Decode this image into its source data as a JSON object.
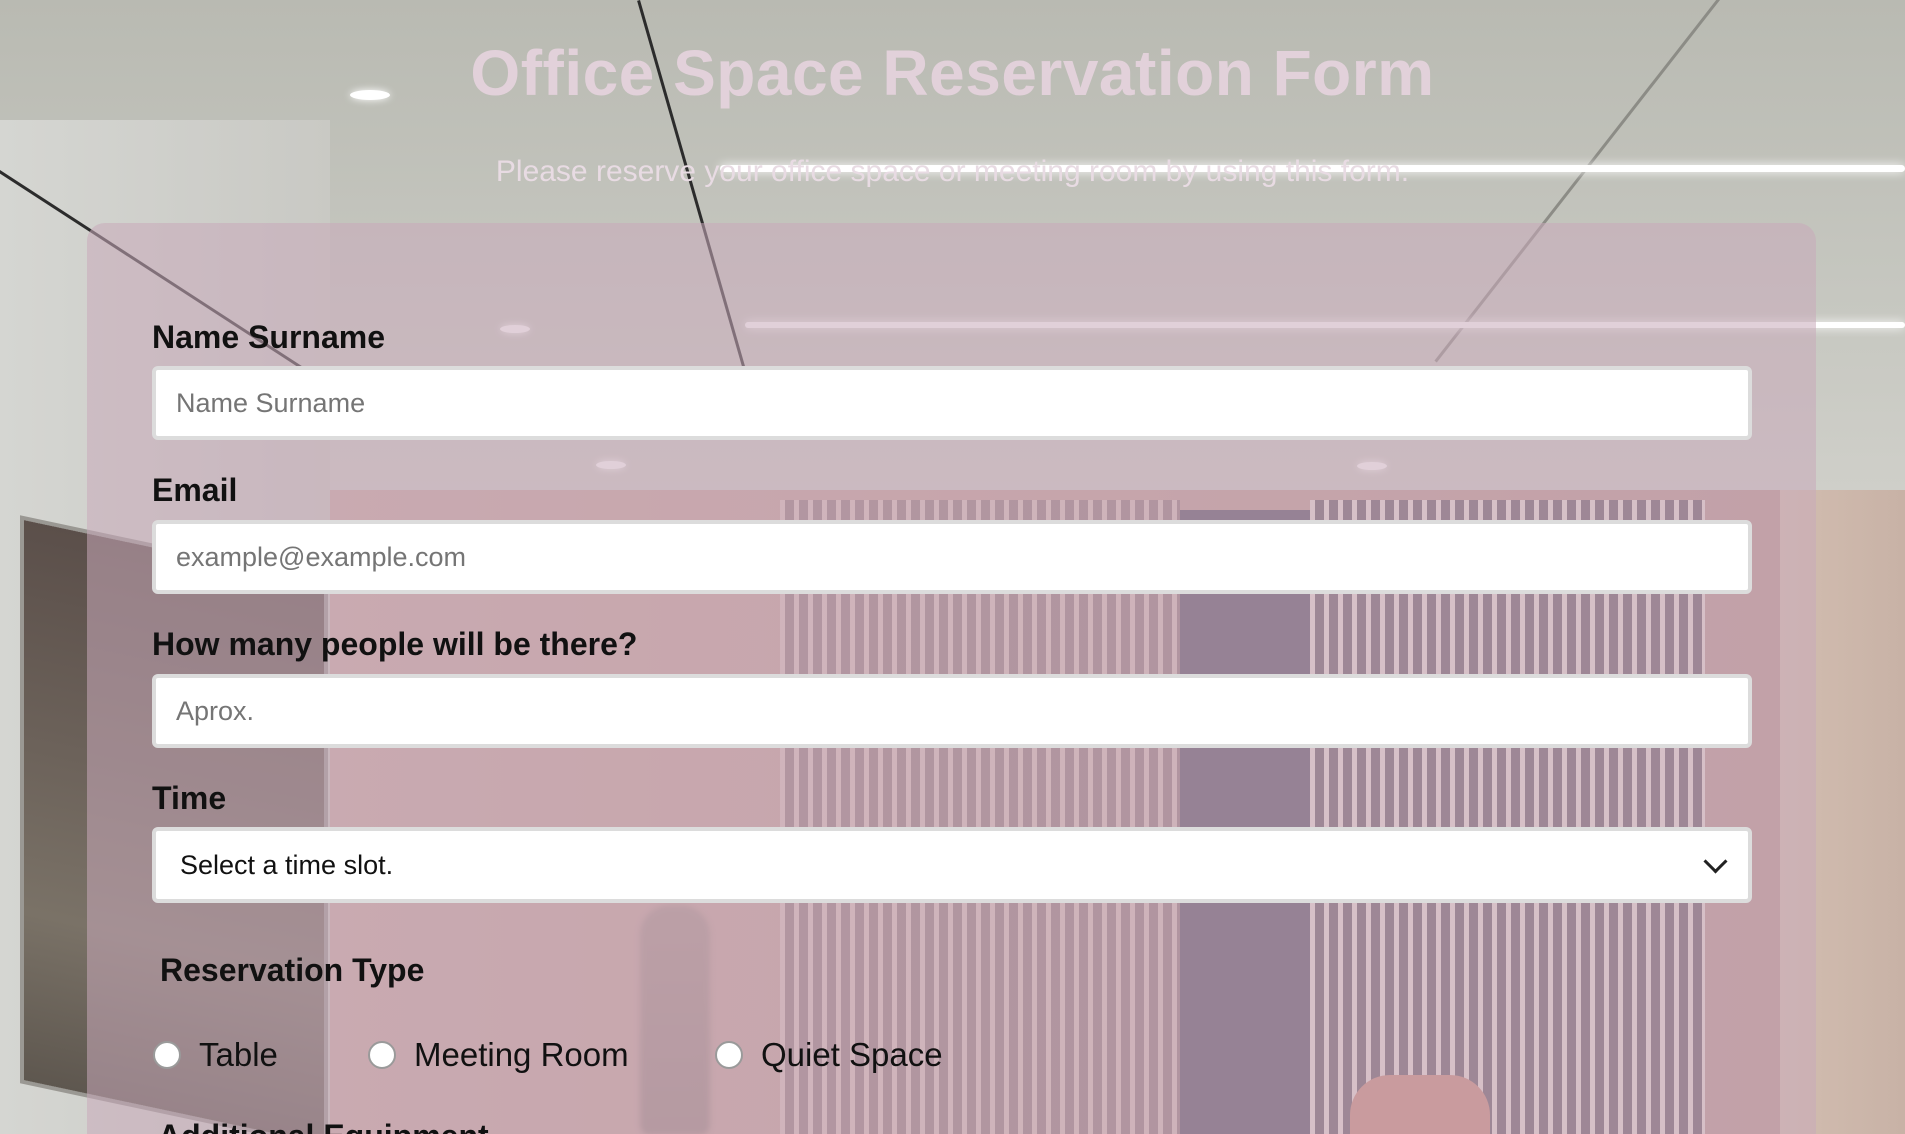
{
  "header": {
    "title": "Office Space Reservation Form",
    "subtitle": "Please reserve your office space or meeting room by using this form."
  },
  "form": {
    "name": {
      "label": "Name Surname",
      "placeholder": "Name Surname",
      "value": ""
    },
    "email": {
      "label": "Email",
      "placeholder": "example@example.com",
      "value": ""
    },
    "people": {
      "label": "How many people will be there?",
      "placeholder": "Aprox.",
      "value": ""
    },
    "time": {
      "label": "Time",
      "selected": "Select a time slot."
    },
    "reservation_type": {
      "label": "Reservation Type",
      "options": [
        {
          "label": "Table",
          "checked": false
        },
        {
          "label": "Meeting Room",
          "checked": false
        },
        {
          "label": "Quiet Space",
          "checked": false
        }
      ]
    },
    "additional_equipment": {
      "label": "Additional Equipment"
    }
  },
  "colors": {
    "title": "#e2d1da",
    "card_background": "#c8aab9",
    "label_text": "#111111"
  },
  "icons": {
    "select_arrow": "chevron-down-icon"
  }
}
